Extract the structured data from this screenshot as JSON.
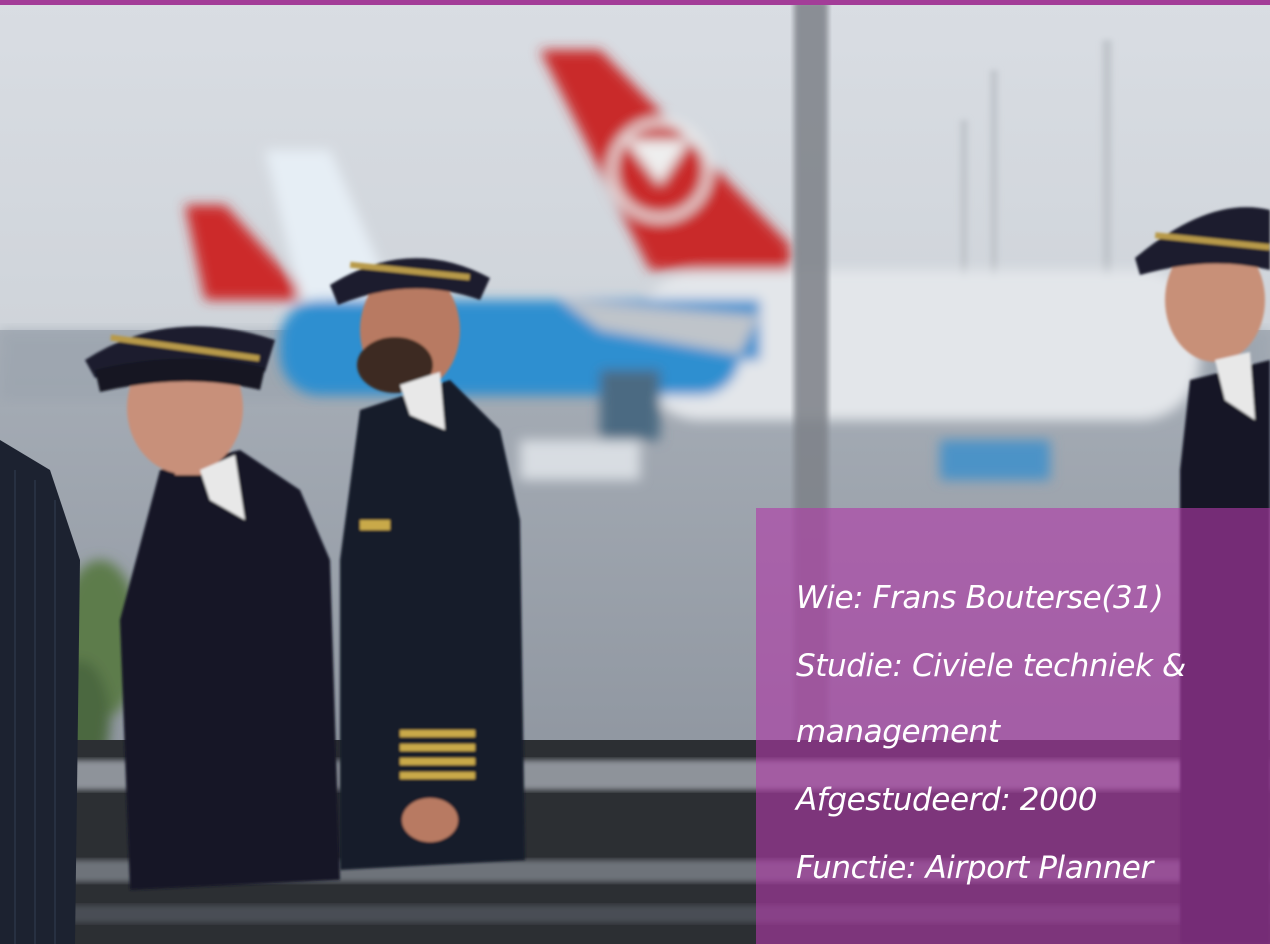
{
  "caption": {
    "lines": [
      "Wie: Frans Bouterse(31)",
      "Studie: Civiele techniek &",
      "management",
      "Afgestudeerd: 2000",
      "Functie: Airport Planner"
    ]
  },
  "colors": {
    "accent_bar": "#a33d98",
    "caption_overlay": "#b03aa8"
  },
  "photo": {
    "subject": "pilots-walking-past-airport-window-with-aircraft-tails"
  }
}
